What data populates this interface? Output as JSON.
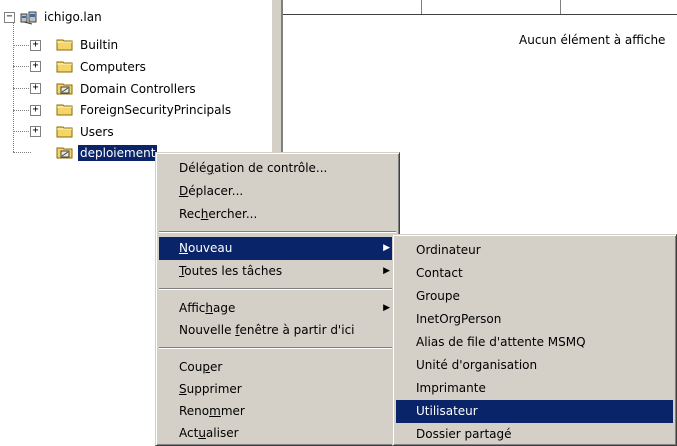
{
  "tree": {
    "root": {
      "label": "ichigo.lan",
      "expander": "−"
    },
    "items": [
      {
        "label": "Builtin",
        "expander": "+",
        "icon": "folder-icon"
      },
      {
        "label": "Computers",
        "expander": "+",
        "icon": "folder-icon"
      },
      {
        "label": "Domain Controllers",
        "expander": "+",
        "icon": "ou-folder-icon"
      },
      {
        "label": "ForeignSecurityPrincipals",
        "expander": "+",
        "icon": "folder-icon"
      },
      {
        "label": "Users",
        "expander": "+",
        "icon": "folder-icon"
      },
      {
        "label": "deploiement",
        "expander": "",
        "icon": "ou-folder-icon",
        "selected": true
      }
    ]
  },
  "right_pane": {
    "empty_message": "Aucun élément à affiche"
  },
  "context_menu": {
    "items": [
      {
        "pre": "Délé",
        "key": "g",
        "post": "ation de contrôle..."
      },
      {
        "pre": "",
        "key": "D",
        "post": "éplacer..."
      },
      {
        "pre": "Rec",
        "key": "h",
        "post": "ercher..."
      },
      {
        "pre": "",
        "key": "N",
        "post": "ouveau",
        "submenu": true,
        "highlighted": true
      },
      {
        "pre": "",
        "key": "T",
        "post": "outes les tâches",
        "submenu": true
      },
      {
        "pre": "Affic",
        "key": "h",
        "post": "age",
        "submenu": true
      },
      {
        "pre": "Nouvelle ",
        "key": "f",
        "post": "enêtre à partir d'ici"
      },
      {
        "pre": "Cou",
        "key": "p",
        "post": "er"
      },
      {
        "pre": "",
        "key": "S",
        "post": "upprimer"
      },
      {
        "pre": "Reno",
        "key": "m",
        "post": "mer"
      },
      {
        "pre": "Act",
        "key": "u",
        "post": "aliser"
      }
    ]
  },
  "submenu_nouveau": {
    "items": [
      {
        "label": "Ordinateur"
      },
      {
        "label": "Contact"
      },
      {
        "label": "Groupe"
      },
      {
        "label": "InetOrgPerson"
      },
      {
        "label": "Alias de file d'attente MSMQ"
      },
      {
        "label": "Unité d'organisation"
      },
      {
        "label": "Imprimante"
      },
      {
        "label": "Utilisateur",
        "highlighted": true
      },
      {
        "label": "Dossier partagé"
      }
    ]
  },
  "colors": {
    "selection": "#0a246a",
    "menu_face": "#d4d0c8",
    "folder": "#f5d46a"
  }
}
